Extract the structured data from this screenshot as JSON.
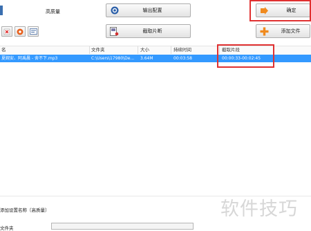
{
  "top": {
    "quality_label": "高质量",
    "output_config_label": "输出配置",
    "confirm_label": "确定",
    "cut_clip_label": "截取片断",
    "add_file_label": "添加文件"
  },
  "table": {
    "headers": [
      "名",
      "文件夹",
      "大小",
      "持续时间",
      "截取片段"
    ],
    "rows": [
      {
        "name": "夏婉安、阿禹晨 - 舍不下.mp3",
        "folder": "C:\\Users\\17980\\De...",
        "size": "3.64M",
        "duration": "00:03:58",
        "clip": "00:00:33-00:02:45"
      }
    ]
  },
  "bottom": {
    "preset_label": "添加设置名称〔高质量〕",
    "folder_label": "文件夹"
  },
  "watermark": "软件技巧",
  "colors": {
    "selection": "#3399ff",
    "highlight": "#e03030"
  }
}
